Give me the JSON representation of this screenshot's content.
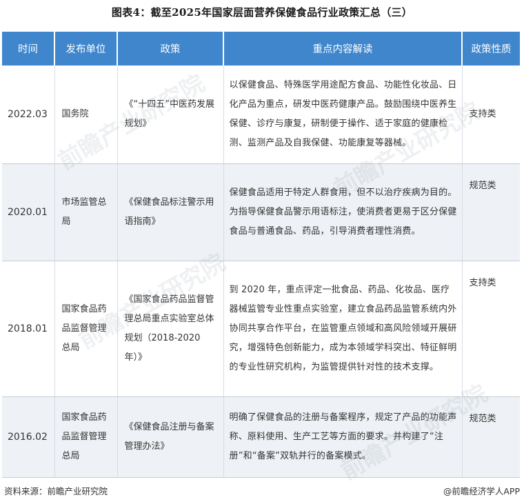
{
  "title": "图表4：截至2025年国家层面营养保健食品行业政策汇总（三）",
  "table": {
    "headers": [
      "时间",
      "发布单位",
      "政策",
      "重点内容解读",
      "政策性质"
    ],
    "rows": [
      {
        "time": "2022.03",
        "issuer": "国务院",
        "policy": "《“十四五”中医药发展规划》",
        "detail": "以保健食品、特殊医学用途配方食品、功能性化妆品、日化产品为重点，研发中医药健康产品。鼓励围绕中医养生保健、诊疗与康复，研制便于操作、适于家庭的健康检测、监测产品及自我保健、功能康复等器械。",
        "type": "支持类"
      },
      {
        "time": "2020.01",
        "issuer": "市场监管总局",
        "policy": "《保健食品标注警示用语指南》",
        "detail": "保健食品适用于特定人群食用，但不以治疗疾病为目的。为指导保健食品警示用语标注，使消费者更易于区分保健食品与普通食品、药品，引导消费者理性消费。",
        "type": "规范类"
      },
      {
        "time": "2018.01",
        "issuer": "国家食品药品监督管理总局",
        "policy": "《国家食品药品监督管理总局重点实验室总体规划（2018-2020年）》",
        "detail": "到 2020 年，重点评定一批食品、药品、化妆品、医疗器械监管专业性重点实验室，建立食品药品监管系统内外协同共享合作平台，在监管重点领域和高风险领域开展研究，增强特色创新能力，成为本领域学科突出、特征鲜明的专业性研究机构，为监管提供针对性的技术支撑。",
        "type": "支持类"
      },
      {
        "time": "2016.02",
        "issuer": "国家食品药品监督管理总局",
        "policy": "《保健食品注册与备案管理办法》",
        "detail": "明确了保健食品的注册与备案程序，规定了产品的功能声称、原料使用、生产工艺等方面的要求。并构建了“注册”和“备案”双轨并行的备案模式。",
        "type": "规范类"
      }
    ]
  },
  "source": "资料来源：前瞻产业研究院",
  "credit": "@前瞻经济学人APP",
  "colors": {
    "header_bg": "#3f86cc",
    "row_alt_bg": "#eef1f5"
  }
}
